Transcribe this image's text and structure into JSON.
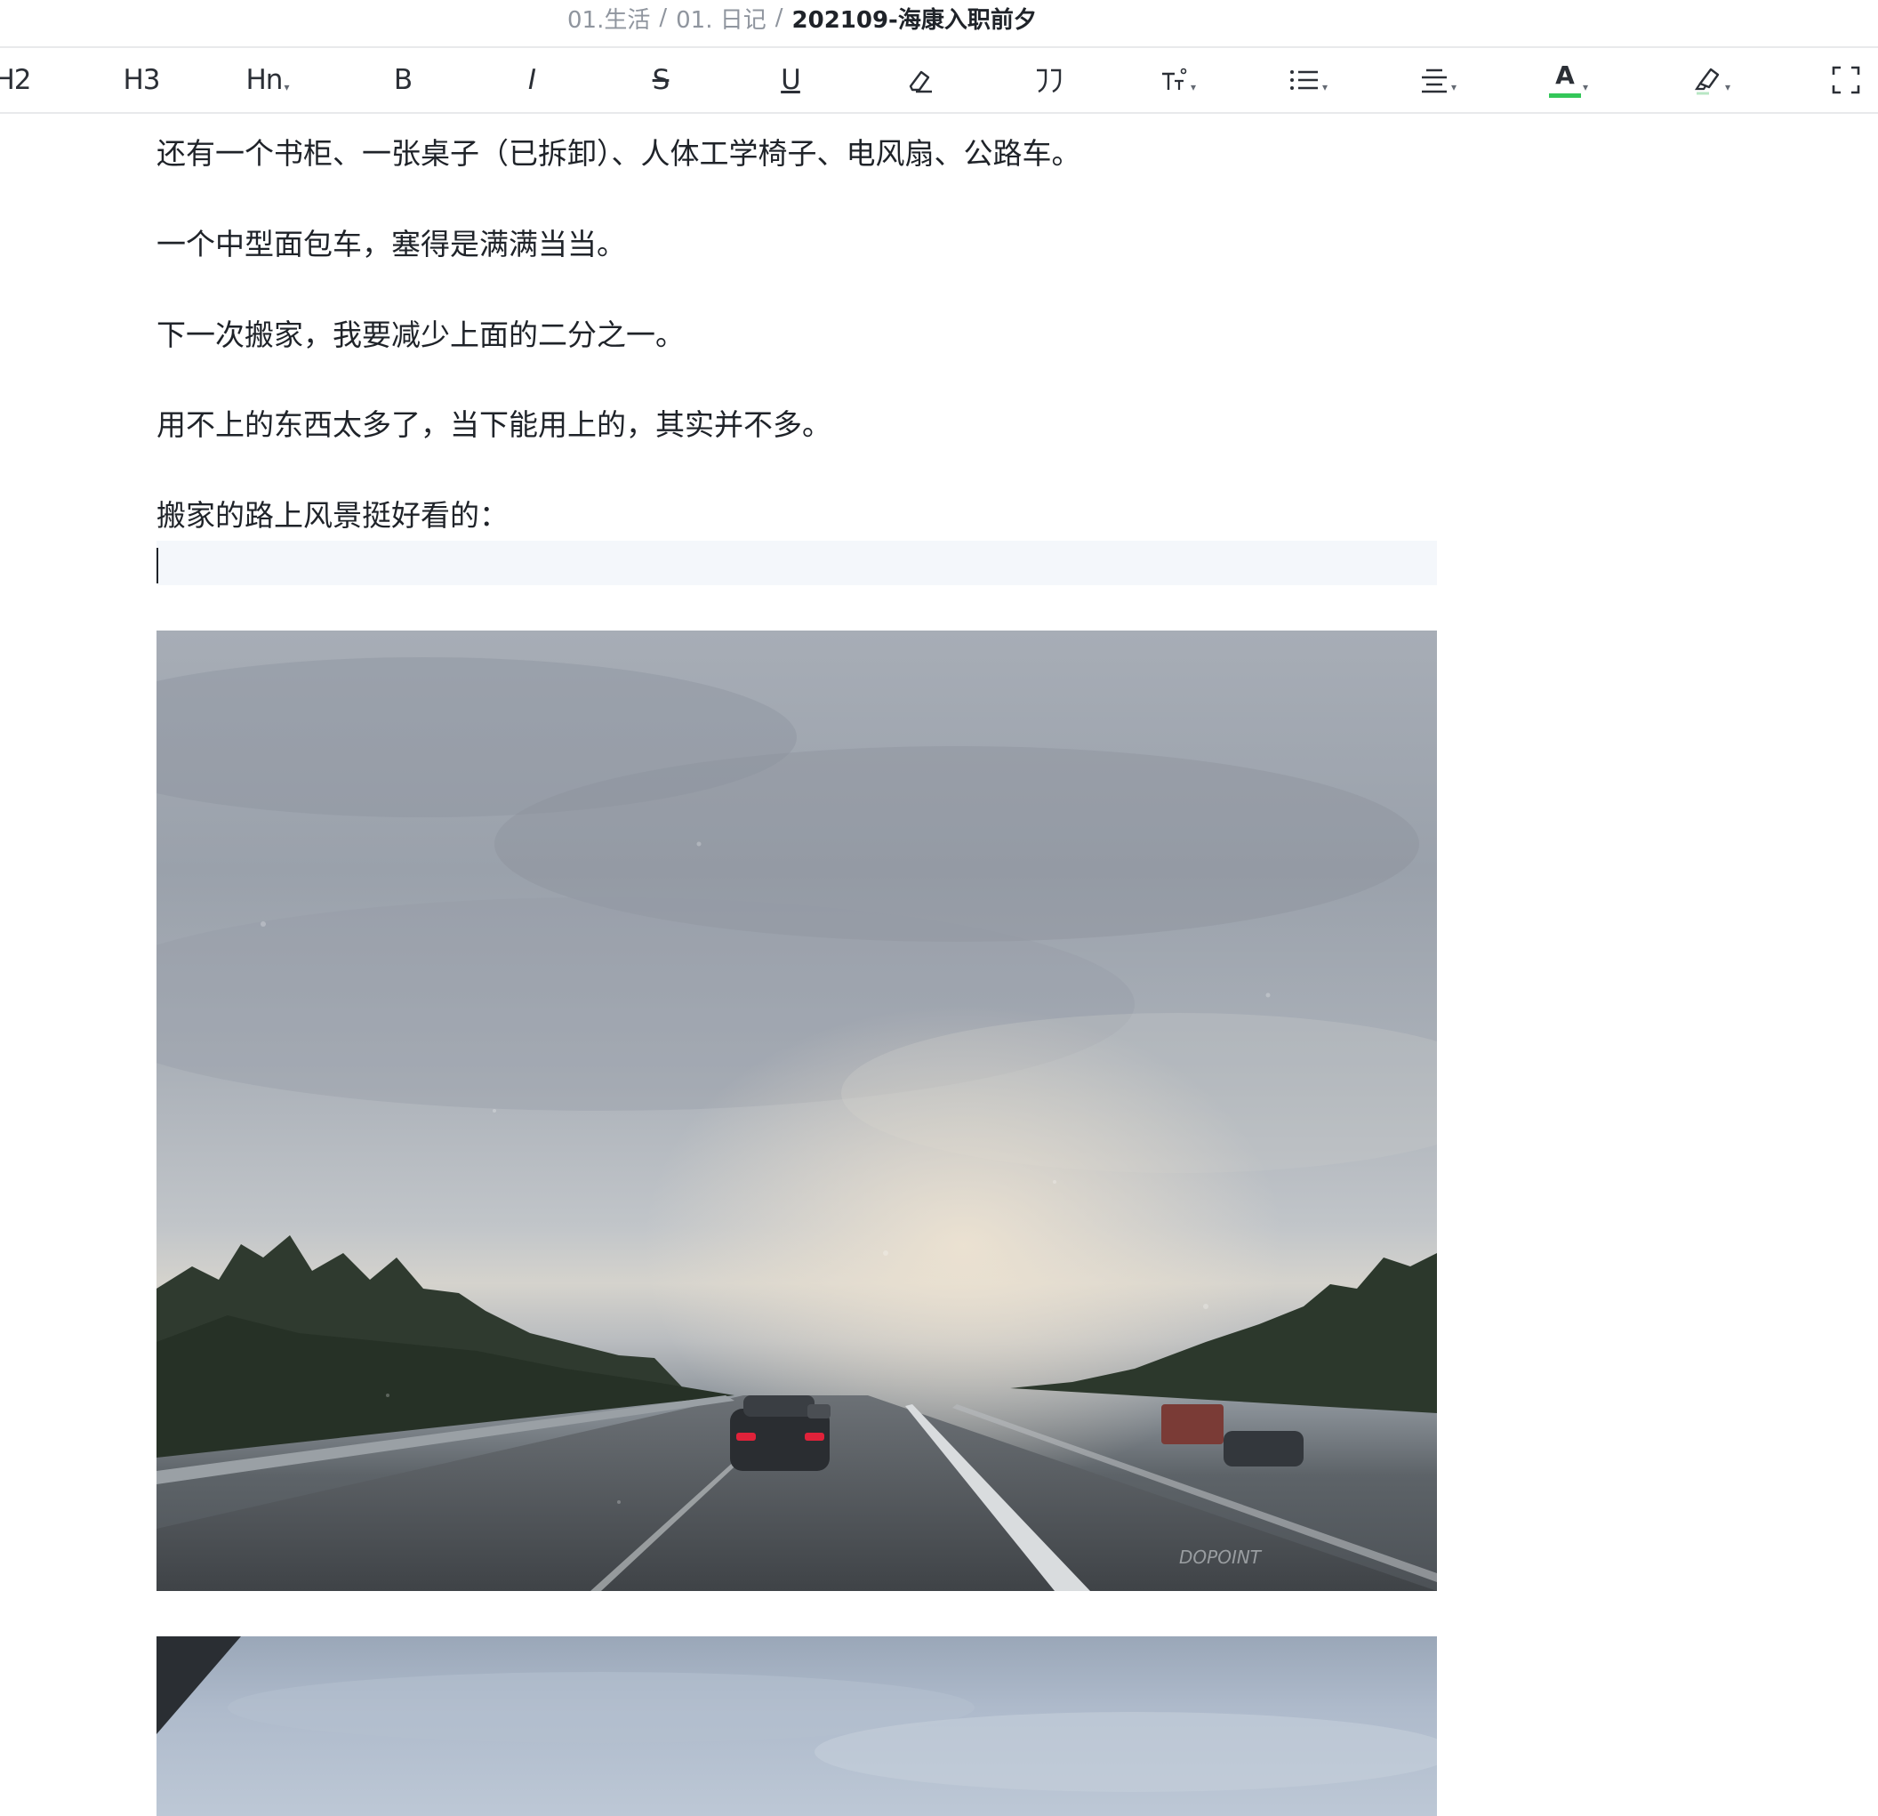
{
  "breadcrumb": {
    "items": [
      "01.生活",
      "01. 日记"
    ],
    "separator": "/",
    "current": "202109-海康入职前夕"
  },
  "toolbar": {
    "h2_label": "H2",
    "h3_label": "H3",
    "hn_label": "Hn",
    "bold_label": "B",
    "italic_label": "I",
    "strike_label": "S",
    "underline_label": "U",
    "font_color_label": "A",
    "font_color_accent": "#34c759",
    "icons": [
      "eraser-icon",
      "quote-icon",
      "font-size-icon",
      "list-icon",
      "align-icon",
      "font-color-icon",
      "highlight-icon",
      "fullscreen-icon"
    ]
  },
  "content": {
    "paragraphs": [
      "还有一个书柜、一张桌子（已拆卸）、人体工学椅子、电风扇、公路车。",
      "一个中型面包车，塞得是满满当当。",
      "下一次搬家，我要减少上面的二分之一。",
      "用不上的东西太多了，当下能用上的，其实并不多。",
      "搬家的路上风景挺好看的："
    ],
    "photo1_watermark": "DOPOINT"
  }
}
